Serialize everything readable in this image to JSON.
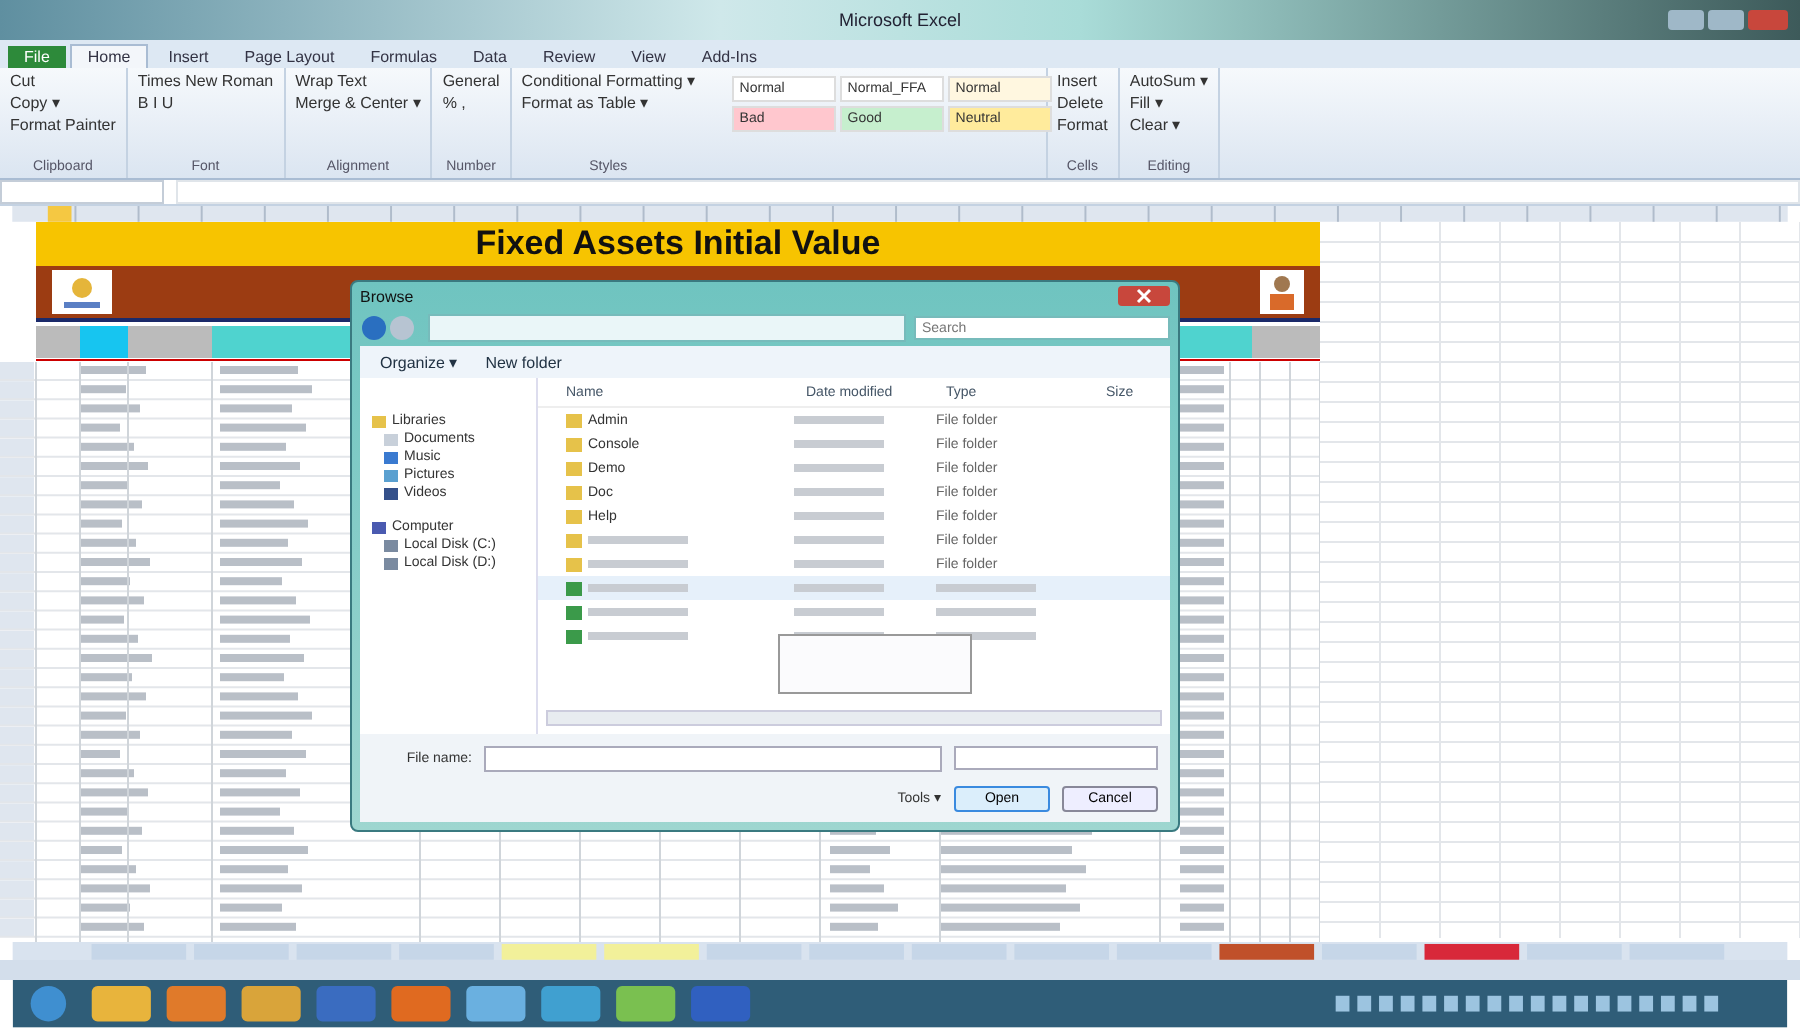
{
  "window": {
    "title": "Microsoft Excel"
  },
  "ribbon_tabs": [
    {
      "label": "File",
      "kind": "file",
      "selected": false
    },
    {
      "label": "Home",
      "kind": "tab",
      "selected": true
    },
    {
      "label": "Insert",
      "kind": "tab",
      "selected": false
    },
    {
      "label": "Page Layout",
      "kind": "tab",
      "selected": false
    },
    {
      "label": "Formulas",
      "kind": "tab",
      "selected": false
    },
    {
      "label": "Data",
      "kind": "tab",
      "selected": false
    },
    {
      "label": "Review",
      "kind": "tab",
      "selected": false
    },
    {
      "label": "View",
      "kind": "tab",
      "selected": false
    },
    {
      "label": "Add-Ins",
      "kind": "tab",
      "selected": false
    }
  ],
  "ribbon_groups": [
    {
      "label": "Clipboard",
      "items": [
        "Cut",
        "Copy ▾",
        "Format Painter"
      ]
    },
    {
      "label": "Font",
      "items": [
        "Times New Roman",
        "B  I  U"
      ]
    },
    {
      "label": "Alignment",
      "items": [
        "Wrap Text",
        "Merge & Center ▾"
      ]
    },
    {
      "label": "Number",
      "items": [
        "General",
        "%  ,"
      ]
    },
    {
      "label": "Styles",
      "items": [
        "Conditional Formatting ▾",
        "Format as Table ▾"
      ]
    },
    {
      "label": "Cells",
      "items": [
        "Insert",
        "Delete",
        "Format"
      ]
    },
    {
      "label": "Editing",
      "items": [
        "AutoSum ▾",
        "Fill ▾",
        "Clear ▾"
      ]
    }
  ],
  "styles": [
    {
      "label": "Normal",
      "color": "#ffffff"
    },
    {
      "label": "Normal_FFA",
      "color": "#ffffff"
    },
    {
      "label": "Normal",
      "color": "#fff7e0"
    },
    {
      "label": "Bad",
      "color": "#ffc7ce"
    },
    {
      "label": "Good",
      "color": "#c6efce"
    },
    {
      "label": "Neutral",
      "color": "#ffeb9c"
    }
  ],
  "sheet": {
    "title": "Fixed Assets Initial Value"
  },
  "dialog": {
    "title": "Browse",
    "search_placeholder": "Search",
    "toolbar": [
      "Organize ▾",
      "New folder"
    ],
    "columns": [
      "Name",
      "Date modified",
      "Type",
      "Size"
    ],
    "nav": [
      {
        "label": "Libraries",
        "kind": "library",
        "children": [
          {
            "label": "Documents",
            "kind": "doc"
          },
          {
            "label": "Music",
            "kind": "music"
          },
          {
            "label": "Pictures",
            "kind": "pic"
          },
          {
            "label": "Videos",
            "kind": "video"
          }
        ]
      },
      {
        "label": "Computer",
        "kind": "computer",
        "children": [
          {
            "label": "Local Disk (C:)",
            "kind": "disk"
          },
          {
            "label": "Local Disk (D:)",
            "kind": "disk"
          }
        ]
      }
    ],
    "files": [
      {
        "name": "Admin",
        "kind": "folder",
        "type": "File folder",
        "selected": false
      },
      {
        "name": "Console",
        "kind": "folder",
        "type": "File folder",
        "selected": false
      },
      {
        "name": "Demo",
        "kind": "folder",
        "type": "File folder",
        "selected": false
      },
      {
        "name": "Doc",
        "kind": "folder",
        "type": "File folder",
        "selected": false
      },
      {
        "name": "Help",
        "kind": "folder",
        "type": "File folder",
        "selected": false
      },
      {
        "kind": "folder",
        "type": "File folder",
        "selected": false
      },
      {
        "kind": "folder",
        "type": "File folder",
        "selected": false
      },
      {
        "kind": "excel",
        "selected": true
      },
      {
        "kind": "excel",
        "selected": false
      },
      {
        "kind": "excel",
        "selected": false
      }
    ],
    "file_name_label": "File name:",
    "tools": "Tools ▾",
    "buttons": [
      "Open",
      "Cancel"
    ]
  }
}
